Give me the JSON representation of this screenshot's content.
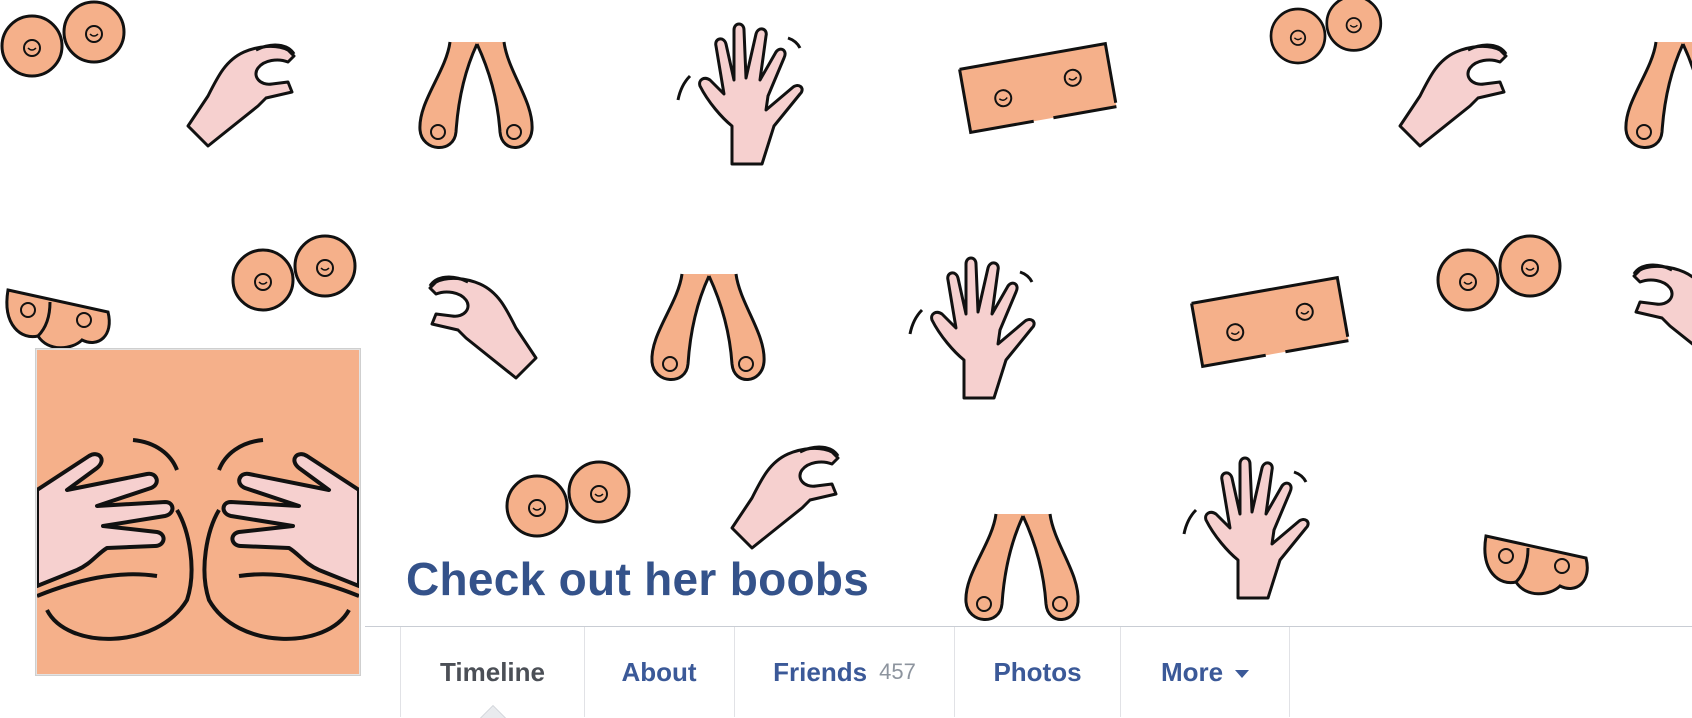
{
  "profile": {
    "name": "Check out her boobs"
  },
  "nav": {
    "tabs": [
      {
        "label": "Timeline",
        "active": true
      },
      {
        "label": "About"
      },
      {
        "label": "Friends",
        "count": "457"
      },
      {
        "label": "Photos"
      },
      {
        "label": "More",
        "has_caret": true
      }
    ]
  },
  "colors": {
    "skin": "#f5b08a",
    "hand": "#f6d0cf",
    "link": "#3b5998",
    "name": "#34528a"
  },
  "icons": [
    "breasts-round-icon",
    "breasts-hanging-icon",
    "breasts-rectangle-icon",
    "pinching-hand-icon",
    "waving-hand-icon"
  ]
}
